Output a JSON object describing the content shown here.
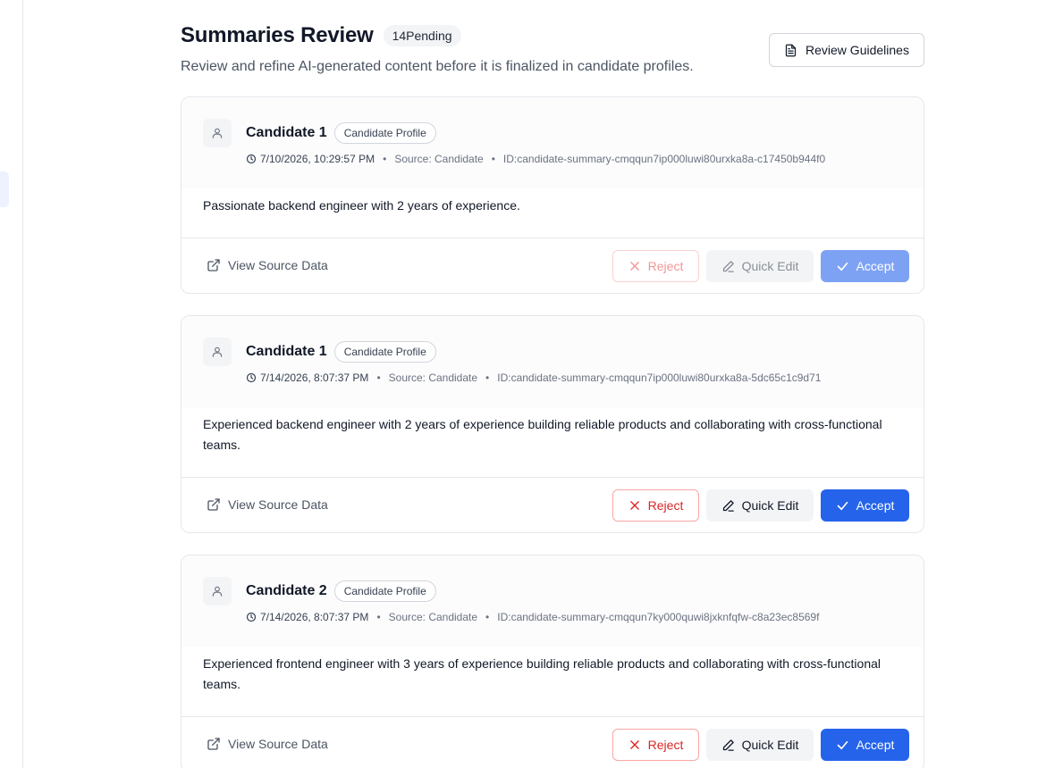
{
  "header": {
    "title": "Summaries Review",
    "pending_badge": "14Pending",
    "subtitle": "Review and refine AI-generated content before it is finalized in candidate profiles.",
    "guidelines_label": "Review Guidelines"
  },
  "cards": [
    {
      "name": "Candidate 1",
      "type": "Candidate Profile",
      "timestamp": "7/10/2026, 10:29:57 PM",
      "source": "Source: Candidate",
      "id": "ID:candidate-summary-cmqqun7ip000luwi80urxka8a-c17450b944f0",
      "summary": "Passionate backend engineer with 2 years of experience.",
      "view_source": "View Source Data",
      "reject": "Reject",
      "edit": "Quick Edit",
      "accept": "Accept"
    },
    {
      "name": "Candidate 1",
      "type": "Candidate Profile",
      "timestamp": "7/14/2026, 8:07:37 PM",
      "source": "Source: Candidate",
      "id": "ID:candidate-summary-cmqqun7ip000luwi80urxka8a-5dc65c1c9d71",
      "summary": "Experienced backend engineer with 2 years of experience building reliable products and collaborating with cross-functional teams.",
      "view_source": "View Source Data",
      "reject": "Reject",
      "edit": "Quick Edit",
      "accept": "Accept"
    },
    {
      "name": "Candidate 2",
      "type": "Candidate Profile",
      "timestamp": "7/14/2026, 8:07:37 PM",
      "source": "Source: Candidate",
      "id": "ID:candidate-summary-cmqqun7ky000quwi8jxknfqfw-c8a23ec8569f",
      "summary": "Experienced frontend engineer with 3 years of experience building reliable products and collaborating with cross-functional teams.",
      "view_source": "View Source Data",
      "reject": "Reject",
      "edit": "Quick Edit",
      "accept": "Accept"
    }
  ],
  "colors": {
    "accent": "#2563eb",
    "reject": "#dc2626"
  },
  "icons": {
    "guidelines": "document-icon",
    "avatar": "user-icon",
    "timestamp": "clock-icon",
    "view_source": "external-link-icon",
    "reject": "x-icon",
    "edit": "pencil-icon",
    "accept": "check-icon"
  }
}
